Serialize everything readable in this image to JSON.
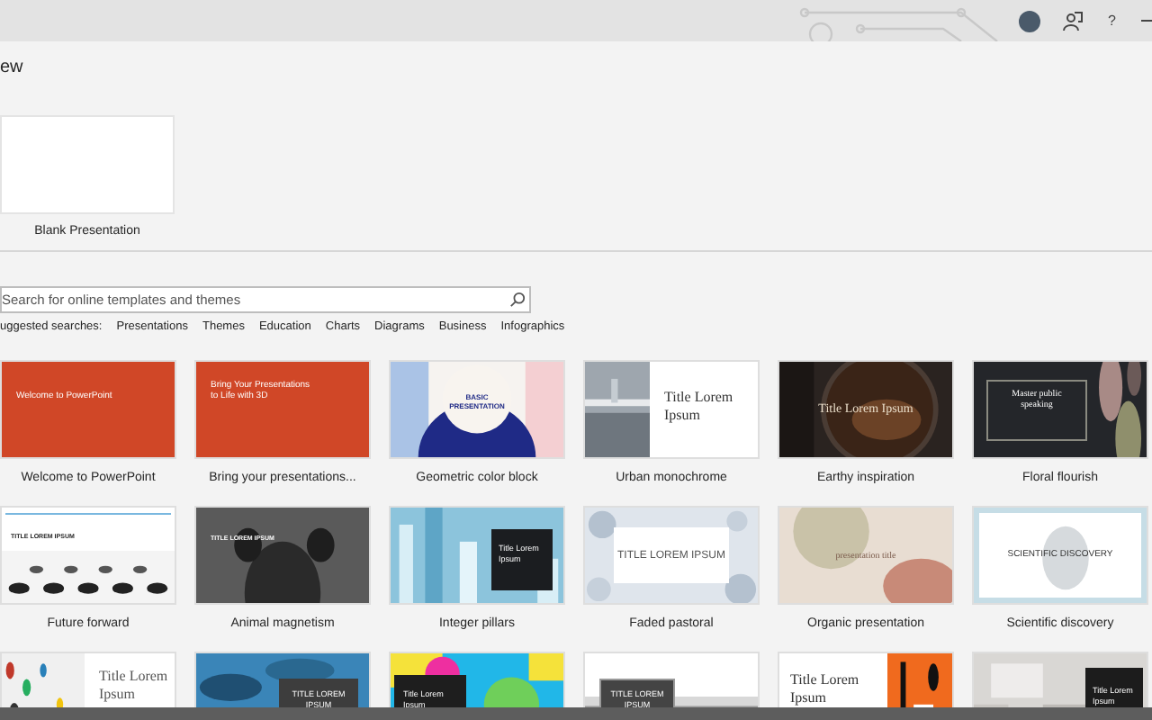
{
  "title_bar": {
    "help": "?"
  },
  "heading": "ew",
  "blank": {
    "label": "Blank Presentation"
  },
  "search": {
    "placeholder": "Search for online templates and themes"
  },
  "suggested": {
    "label": "uggested searches:",
    "links": [
      "Presentations",
      "Themes",
      "Education",
      "Charts",
      "Diagrams",
      "Business",
      "Infographics"
    ]
  },
  "templates": [
    {
      "kind": "welcome",
      "title": "Welcome to PowerPoint",
      "name": "Welcome to PowerPoint"
    },
    {
      "kind": "bring3d",
      "title": "Bring Your Presentations to Life with 3D",
      "name": "Bring your presentations..."
    },
    {
      "kind": "geometric",
      "title": "BASIC PRESENTATION",
      "name": "Geometric color block"
    },
    {
      "kind": "urban",
      "title": "Title Lorem Ipsum",
      "name": "Urban monochrome"
    },
    {
      "kind": "earthy",
      "title": "Title Lorem Ipsum",
      "name": "Earthy inspiration"
    },
    {
      "kind": "floral",
      "title": "Master public speaking",
      "name": "Floral flourish"
    },
    {
      "kind": "future",
      "title": "TITLE LOREM IPSUM",
      "name": "Future forward"
    },
    {
      "kind": "animal",
      "title": "TITLE LOREM IPSUM",
      "name": "Animal magnetism"
    },
    {
      "kind": "integer",
      "title": "Title Lorem Ipsum",
      "name": "Integer pillars"
    },
    {
      "kind": "pastoral",
      "title": "TITLE LOREM IPSUM",
      "name": "Faded pastoral"
    },
    {
      "kind": "organic",
      "title": "presentation title",
      "name": "Organic presentation"
    },
    {
      "kind": "scientific",
      "title": "SCIENTIFIC DISCOVERY",
      "name": "Scientific discovery"
    },
    {
      "kind": "dots",
      "title": "Title Lorem Ipsum"
    },
    {
      "kind": "bluewaves",
      "title": "TITLE LOREM IPSUM"
    },
    {
      "kind": "colorful",
      "title": "Title Lorem Ipsum"
    },
    {
      "kind": "greywaves",
      "title": "TITLE LOREM IPSUM"
    },
    {
      "kind": "orangeabstract",
      "title": "Title Lorem Ipsum"
    },
    {
      "kind": "polygons",
      "title": "Title Lorem Ipsum"
    }
  ]
}
